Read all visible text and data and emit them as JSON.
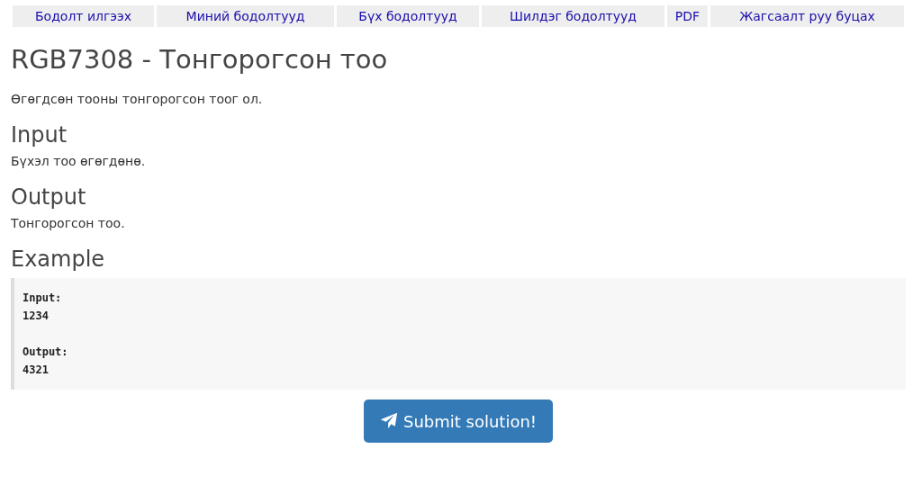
{
  "nav": [
    {
      "label": "Бодолт илгээх"
    },
    {
      "label": "Миний бодолтууд"
    },
    {
      "label": "Бүх бодолтууд"
    },
    {
      "label": "Шилдэг бодолтууд"
    },
    {
      "label": "PDF"
    },
    {
      "label": "Жагсаалт руу буцах"
    }
  ],
  "title": "RGB7308 - Тонгорогсон тоо",
  "statement": "Өгөгдсөн тооны тонгорогсон тоог ол.",
  "sections": [
    {
      "heading": "Input",
      "text": "Бүхэл тоо өгөгдөнө."
    },
    {
      "heading": "Output",
      "text": "Тонгорогсон тоо."
    }
  ],
  "example": {
    "heading": "Example",
    "blocks": [
      {
        "label": "Input:",
        "value": "1234"
      },
      {
        "label": "Output:",
        "value": "4321"
      }
    ]
  },
  "submit_button": "Submit solution!"
}
